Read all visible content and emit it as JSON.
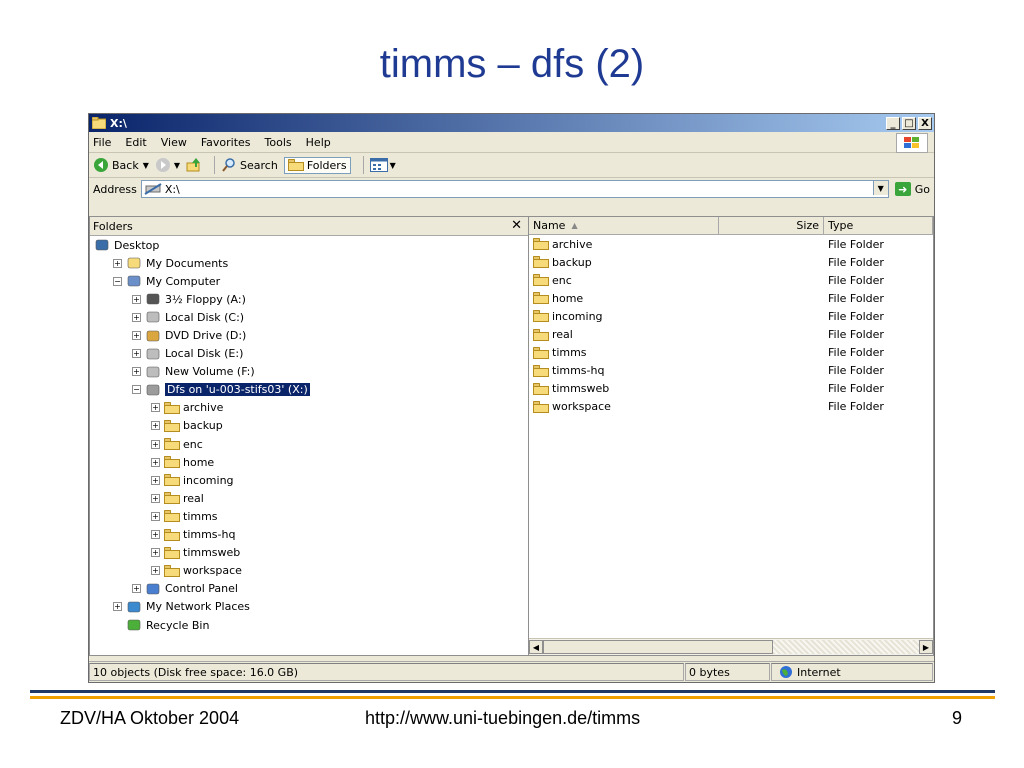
{
  "slide": {
    "title": "timms – dfs (2)",
    "footer_left": "ZDV/HA Oktober 2004",
    "footer_center": "http://www.uni-tuebingen.de/timms",
    "footer_right": "9"
  },
  "window": {
    "title": "X:\\",
    "controls": [
      "_",
      "□",
      "X"
    ]
  },
  "menu": [
    "File",
    "Edit",
    "View",
    "Favorites",
    "Tools",
    "Help"
  ],
  "toolbar": {
    "back": "Back",
    "search": "Search",
    "folders": "Folders"
  },
  "address": {
    "label": "Address",
    "value": "X:\\",
    "go": "Go"
  },
  "tree": {
    "header": "Folders",
    "close": "✕",
    "items": [
      {
        "label": "Desktop",
        "expander": "",
        "icon": "desktop-icon"
      },
      {
        "label": "My Documents",
        "expander": "+",
        "icon": "my-documents-icon"
      },
      {
        "label": "My Computer",
        "expander": "−",
        "icon": "my-computer-icon"
      },
      {
        "label": "3½ Floppy (A:)",
        "expander": "+",
        "icon": "floppy-icon"
      },
      {
        "label": "Local Disk (C:)",
        "expander": "+",
        "icon": "hard-disk-icon"
      },
      {
        "label": "DVD Drive (D:)",
        "expander": "+",
        "icon": "dvd-icon"
      },
      {
        "label": "Local Disk (E:)",
        "expander": "+",
        "icon": "hard-disk-icon"
      },
      {
        "label": "New Volume (F:)",
        "expander": "+",
        "icon": "hard-disk-icon"
      },
      {
        "label": "Dfs on 'u-003-stifs03' (X:)",
        "expander": "−",
        "icon": "network-drive-icon"
      },
      {
        "label": "archive",
        "expander": "+",
        "icon": "folder-icon"
      },
      {
        "label": "backup",
        "expander": "+",
        "icon": "folder-icon"
      },
      {
        "label": "enc",
        "expander": "+",
        "icon": "folder-icon"
      },
      {
        "label": "home",
        "expander": "+",
        "icon": "folder-icon"
      },
      {
        "label": "incoming",
        "expander": "+",
        "icon": "folder-icon"
      },
      {
        "label": "real",
        "expander": "+",
        "icon": "folder-icon"
      },
      {
        "label": "timms",
        "expander": "+",
        "icon": "folder-icon"
      },
      {
        "label": "timms-hq",
        "expander": "+",
        "icon": "folder-icon"
      },
      {
        "label": "timmsweb",
        "expander": "+",
        "icon": "folder-icon"
      },
      {
        "label": "workspace",
        "expander": "+",
        "icon": "folder-icon"
      },
      {
        "label": "Control Panel",
        "expander": "+",
        "icon": "control-panel-icon"
      },
      {
        "label": "My Network Places",
        "expander": "+",
        "icon": "network-places-icon"
      },
      {
        "label": "Recycle Bin",
        "expander": "",
        "icon": "recycle-bin-icon"
      }
    ]
  },
  "files": {
    "columns": {
      "name": "Name",
      "size": "Size",
      "type": "Type"
    },
    "rows": [
      {
        "name": "archive",
        "size": "",
        "type": "File Folder"
      },
      {
        "name": "backup",
        "size": "",
        "type": "File Folder"
      },
      {
        "name": "enc",
        "size": "",
        "type": "File Folder"
      },
      {
        "name": "home",
        "size": "",
        "type": "File Folder"
      },
      {
        "name": "incoming",
        "size": "",
        "type": "File Folder"
      },
      {
        "name": "real",
        "size": "",
        "type": "File Folder"
      },
      {
        "name": "timms",
        "size": "",
        "type": "File Folder"
      },
      {
        "name": "timms-hq",
        "size": "",
        "type": "File Folder"
      },
      {
        "name": "timmsweb",
        "size": "",
        "type": "File Folder"
      },
      {
        "name": "workspace",
        "size": "",
        "type": "File Folder"
      }
    ]
  },
  "status": {
    "objects": "10 objects (Disk free space: 16.0 GB)",
    "size": "0 bytes",
    "zone": "Internet"
  },
  "colors": {
    "title_blue": "#1f3a93",
    "selection": "#0a246a",
    "footer_navy": "#1f3a66",
    "footer_orange": "#f0a000"
  }
}
